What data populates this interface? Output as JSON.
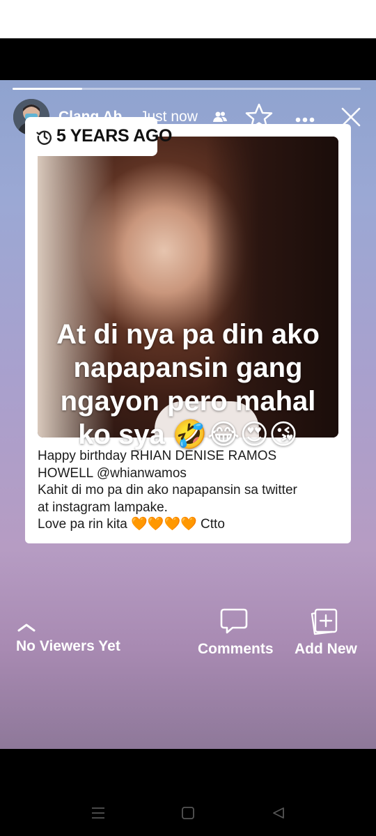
{
  "story": {
    "progress": 0.2,
    "author": "Clang Ab...",
    "timestamp": "Just now",
    "icons": {
      "audience": "friends-icon",
      "favorite": "star-icon",
      "more": "more-icon",
      "close": "close-icon"
    }
  },
  "memory": {
    "tag": "5 YEARS AGO",
    "overlay_lines": [
      "At di nya pa din ako",
      "napapansin gang",
      "ngayon pero mahal",
      "ko sya 🤣😂😍😘"
    ],
    "caption_lines": [
      "Happy birthday RHIAN DENISE RAMOS",
      "HOWELL @whianwamos",
      "Kahit di mo pa din ako napapansin sa twitter",
      "at instagram lampake.",
      "Love pa rin kita 🧡🧡🧡🧡 Ctto"
    ]
  },
  "bottom": {
    "viewers": "No Viewers Yet",
    "comments": "Comments",
    "add_new": "Add New"
  },
  "colors": {
    "gradient_top": "#8fa3cf",
    "gradient_bottom": "#8e7899",
    "card": "#ffffff"
  }
}
